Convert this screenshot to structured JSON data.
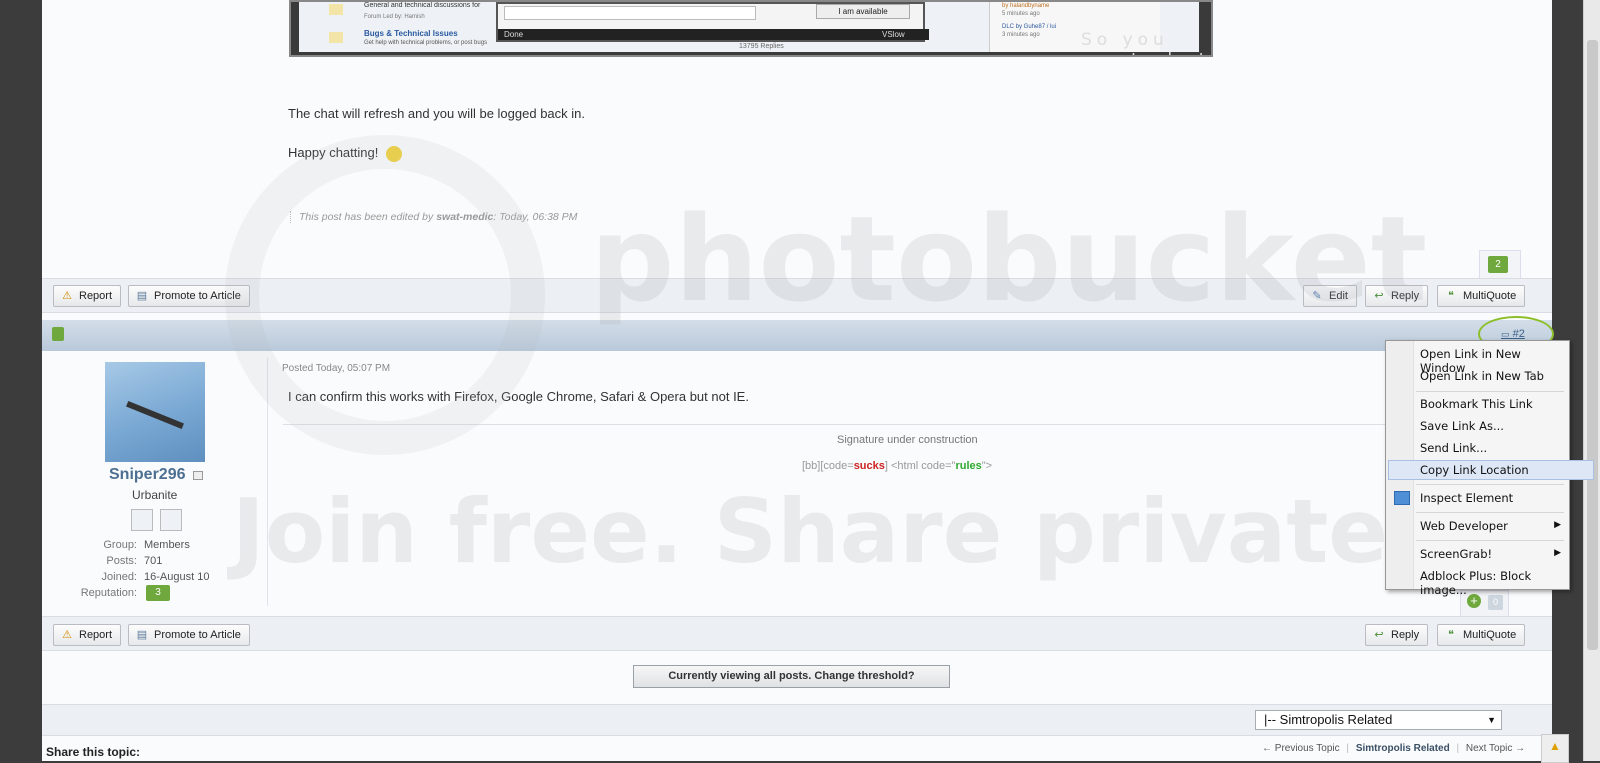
{
  "screenshot_embed": {
    "items": [
      {
        "title": "",
        "desc": "General and technical discussions for",
        "meta": "Forum Led by: Hamish"
      },
      {
        "title": "Bugs & Technical Issues",
        "desc": "Get help with technical problems, or post bugs"
      }
    ],
    "available_button": "I am available",
    "status_done": "Done",
    "status_speed": "VSlow",
    "caption": "So you want chat in a tab, eh?",
    "replies": "13795 Replies",
    "side": [
      "by halandbyname",
      "5 minutes ago",
      "DLC by Guhe87 / lui",
      "3 minutes ago"
    ]
  },
  "post1": {
    "text1": "The chat will refresh and you will be logged back in.",
    "text2": "Happy chatting!",
    "edited_prefix": "This post has been edited by",
    "edited_by": "swat-medic",
    "edited_time": ": Today, 06:38 PM",
    "rep": "2",
    "buttons": {
      "report": "Report",
      "promote": "Promote to Article",
      "edit": "Edit",
      "reply": "Reply",
      "multiquote": "MultiQuote"
    }
  },
  "post2": {
    "link": "#2",
    "posted_label": "Posted",
    "posted_time": "Today, 05:07 PM",
    "text": "I can confirm this works with Firefox, Google Chrome, Safari & Opera but not IE.",
    "signature": "Signature under construction",
    "sig_code": {
      "p1": "[bb][code=",
      "w1": "sucks",
      "p2": "] <html code=\"",
      "w2": "rules",
      "p3": "\">"
    },
    "user": {
      "name": "Sniper296",
      "title": "Urbanite",
      "group_label": "Group:",
      "group": "Members",
      "posts_label": "Posts:",
      "posts": "701",
      "joined_label": "Joined:",
      "joined": "16-August 10",
      "rep_label": "Reputation:",
      "rep": "3"
    },
    "rep_count": "0",
    "buttons": {
      "report": "Report",
      "promote": "Promote to Article",
      "reply": "Reply",
      "multiquote": "MultiQuote"
    }
  },
  "threshold_button": "Currently viewing all posts. Change threshold?",
  "forum_select": "|-- Simtropolis Related",
  "share_title": "Share this topic:",
  "nav": {
    "prev": "← Previous Topic",
    "current": "Simtropolis Related",
    "next": "Next Topic →"
  },
  "watermark": {
    "brand": "photobucket",
    "slogan": "Join free. Share privately."
  },
  "context_menu": {
    "items": [
      "Open Link in New Window",
      "Open Link in New Tab",
      "Bookmark This Link",
      "Save Link As...",
      "Send Link...",
      "Copy Link Location",
      "Inspect Element",
      "Web Developer",
      "ScreenGrab!",
      "Adblock Plus: Block image..."
    ],
    "highlight_color": "#dde7f5"
  },
  "colors": {
    "accent_green": "#6fa83c",
    "username": "#4d6f92",
    "header_blue": "#c3d2e1",
    "sucks": "#cc2222",
    "rules": "#2faa2f",
    "annotation": "#8cbf2a"
  }
}
